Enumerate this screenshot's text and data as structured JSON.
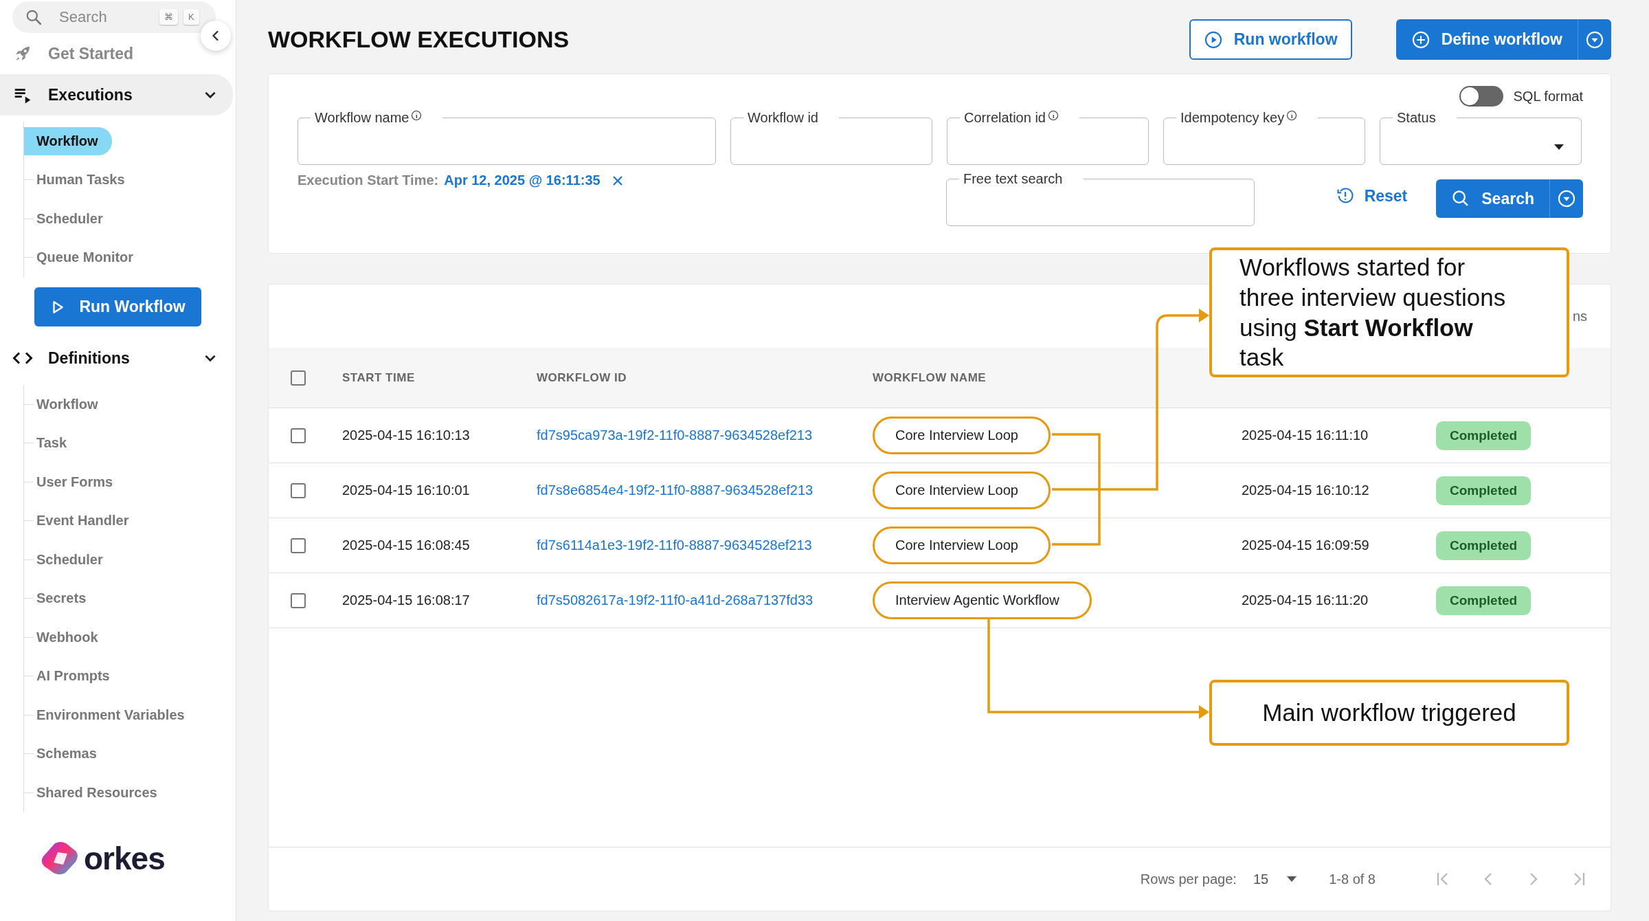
{
  "sidebar": {
    "search": {
      "placeholder": "Search",
      "keys": [
        "⌘",
        "K"
      ]
    },
    "nav": [
      {
        "kind": "link",
        "label": "Get Started",
        "selected": false
      },
      {
        "kind": "group",
        "label": "Executions",
        "selected": true,
        "expanded": true,
        "children": [
          {
            "label": "Workflow",
            "selected": true
          },
          {
            "label": "Human Tasks",
            "selected": false
          },
          {
            "label": "Scheduler",
            "selected": false
          },
          {
            "label": "Queue Monitor",
            "selected": false
          }
        ]
      },
      {
        "kind": "button",
        "label": "Run Workflow"
      },
      {
        "kind": "group",
        "label": "Definitions",
        "selected": false,
        "expanded": true,
        "children": [
          {
            "label": "Workflow",
            "selected": false
          },
          {
            "label": "Task",
            "selected": false
          },
          {
            "label": "User Forms",
            "selected": false
          },
          {
            "label": "Event Handler",
            "selected": false
          },
          {
            "label": "Scheduler",
            "selected": false
          },
          {
            "label": "Secrets",
            "selected": false
          },
          {
            "label": "Webhook",
            "selected": false
          },
          {
            "label": "AI Prompts",
            "selected": false
          },
          {
            "label": "Environment Variables",
            "selected": false
          },
          {
            "label": "Schemas",
            "selected": false
          },
          {
            "label": "Shared Resources",
            "selected": false
          }
        ]
      }
    ],
    "logo": "orkes"
  },
  "header": {
    "title": "WORKFLOW EXECUTIONS",
    "run_button": "Run workflow",
    "define_button": "Define workflow"
  },
  "filters": {
    "sql_toggle": {
      "label": "SQL format",
      "on": false
    },
    "fields": [
      {
        "kind": "text",
        "label": "Workflow name",
        "info": true
      },
      {
        "kind": "text",
        "label": "Workflow id",
        "info": false
      },
      {
        "kind": "text",
        "label": "Correlation id",
        "info": true
      },
      {
        "kind": "text",
        "label": "Idempotency key",
        "info": true
      },
      {
        "kind": "select",
        "label": "Status",
        "info": false
      }
    ],
    "start_time": {
      "label": "Execution Start Time:",
      "value": "Apr 12, 2025 @ 16:11:35"
    },
    "free_text": {
      "label": "Free text search"
    },
    "reset_button": "Reset",
    "search_button": "Search"
  },
  "table": {
    "toolbar_fragment": "ns",
    "columns": [
      "START TIME",
      "WORKFLOW ID",
      "WORKFLOW NAME"
    ],
    "all_selected": false,
    "rows": [
      {
        "start_time": "2025-04-15 16:10:13",
        "workflow_id": "fd7s95ca973a-19f2-11f0-8887-9634528ef213",
        "workflow_name": "Core Interview Loop",
        "highlighted": true,
        "end_time": "2025-04-15 16:11:10",
        "status": "Completed",
        "selected": false
      },
      {
        "start_time": "2025-04-15 16:10:01",
        "workflow_id": "fd7s8e6854e4-19f2-11f0-8887-9634528ef213",
        "workflow_name": "Core Interview Loop",
        "highlighted": true,
        "end_time": "2025-04-15 16:10:12",
        "status": "Completed",
        "selected": false
      },
      {
        "start_time": "2025-04-15 16:08:45",
        "workflow_id": "fd7s6114a1e3-19f2-11f0-8887-9634528ef213",
        "workflow_name": "Core Interview Loop",
        "highlighted": true,
        "end_time": "2025-04-15 16:09:59",
        "status": "Completed",
        "selected": false
      },
      {
        "start_time": "2025-04-15 16:08:17",
        "workflow_id": "fd7s5082617a-19f2-11f0-a41d-268a7137fd33",
        "workflow_name": "Interview Agentic Workflow",
        "highlighted": true,
        "end_time": "2025-04-15 16:11:20",
        "status": "Completed",
        "selected": false
      }
    ],
    "pagination": {
      "rows_label": "Rows per page:",
      "rows_value": "15",
      "range": "1-8 of 8",
      "buttons": [
        {
          "disabled": true
        },
        {
          "disabled": true
        },
        {
          "disabled": true
        },
        {
          "disabled": true
        }
      ]
    }
  },
  "annotations": [
    {
      "text": "Workflows started for three interview questions using **Start Workflow** task"
    },
    {
      "text": "Main workflow triggered"
    }
  ]
}
